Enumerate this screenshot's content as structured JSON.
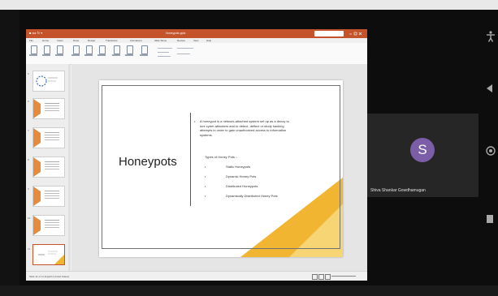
{
  "powerpoint": {
    "window_title": "Honeypots.pptx",
    "ribbon_tabs": [
      "File",
      "Home",
      "Insert",
      "Draw",
      "Design",
      "Transitions",
      "Animations",
      "Slide Show",
      "Review",
      "View",
      "Help"
    ],
    "status_left": "Slide 11 of 11   English (United States)",
    "slide_numbers": [
      "5",
      "6",
      "7",
      "8",
      "9",
      "10",
      "11"
    ]
  },
  "slide": {
    "title": "Honeypots",
    "bullet": "A honeypot is a network-attached system set up as a decoy to lure cyber-attackers and to detect, deflect or study hacking attempts in order to gain unauthorized access to information systems.",
    "types_heading": "Types of Honey Pots :-",
    "types": [
      "Static Honeypots",
      "Dynamic Honey Pots",
      "Distributed Honeypots",
      "Dynamically Distributed Honey Pots"
    ]
  },
  "participant": {
    "initial": "S",
    "name": "Shiva Shankar Gowdhamugan",
    "avatar_color": "#7b5ea7"
  },
  "side_controls": [
    "accessibility-icon",
    "back-icon",
    "home-icon",
    "recents-icon"
  ]
}
